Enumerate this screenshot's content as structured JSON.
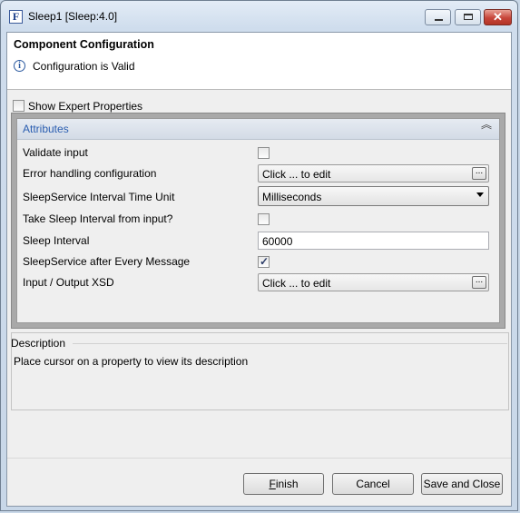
{
  "window": {
    "title": "Sleep1 [Sleep:4.0]",
    "icon_letter": "F",
    "controls": {
      "minimize": "minimize",
      "maximize": "maximize",
      "close": "✕"
    }
  },
  "header": {
    "title": "Component Configuration",
    "status": "Configuration is Valid",
    "status_icon": "info-icon"
  },
  "expert": {
    "label": "Show Expert Properties",
    "checked": false
  },
  "attributes": {
    "section_title": "Attributes",
    "collapse_glyph": "⌃⌃",
    "properties": [
      {
        "label": "Validate input",
        "type": "checkbox",
        "checked": false
      },
      {
        "label": "Error handling configuration",
        "type": "editor",
        "value": "Click ... to edit",
        "button": "..."
      },
      {
        "label": "SleepService Interval Time Unit",
        "type": "select",
        "value": "Milliseconds"
      },
      {
        "label": "Take Sleep Interval from input?",
        "type": "checkbox",
        "checked": false
      },
      {
        "label": "Sleep Interval",
        "type": "text",
        "value": "60000"
      },
      {
        "label": "SleepService after Every Message",
        "type": "checkbox",
        "checked": true
      },
      {
        "label": "Input / Output XSD",
        "type": "editor",
        "value": "Click ... to edit",
        "button": "..."
      }
    ]
  },
  "description": {
    "title": "Description",
    "text": "Place cursor on a property to view its description"
  },
  "buttons": {
    "finish_first": "F",
    "finish_rest": "inish",
    "cancel": "Cancel",
    "save_close": "Save and Close"
  },
  "colors": {
    "accent": "#2a5db0",
    "close_button": "#c7453a"
  }
}
